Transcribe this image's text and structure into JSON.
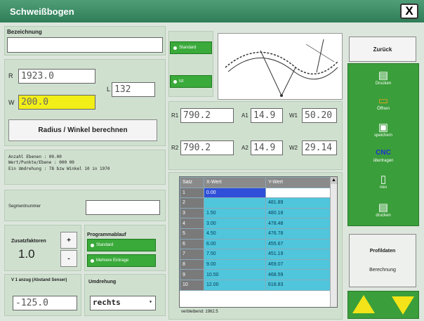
{
  "window": {
    "title": "Schweißbogen",
    "close": "X"
  },
  "left": {
    "bezeichnung_label": "Bezeichnung",
    "bezeichnung_value": "",
    "r_label": "R",
    "r_value": "1923.0",
    "w_label": "W",
    "w_value": "200.0",
    "l_label": "L",
    "l_value": "132",
    "calc_button": "Radius / Winkel berechnen",
    "info_lines": [
      "Anzahl Ebenen : 00.00",
      "Wert/Punkte/Ebene   : 000 00",
      "Ein Umdrehung : 78 bzw Winkel  10 in 1970"
    ],
    "seg_label": "Segmentnummer",
    "seg_value": "",
    "zusatz_label": "Zusatzfaktoren",
    "zusatz_value": "1.0",
    "plus": "+",
    "minus": "-",
    "program_label": "Programmablauf",
    "prog_opt1": "Standard",
    "prog_opt2": "Mehrere Eintrage",
    "v1_label": "V 1 anzug (Abstand Senser)",
    "v1_value": "-125.0",
    "richtung_label": "Umdrehung",
    "richtung_value": "rechts"
  },
  "middle": {
    "opt_top": "Standard",
    "opt_bottom": "Ist",
    "row1": {
      "l1": "R1",
      "v1": "790.2",
      "l2": "A1",
      "v2": "14.9",
      "l3": "W1",
      "v3": "50.20"
    },
    "row2": {
      "l1": "R2",
      "v1": "790.2",
      "l2": "A2",
      "v2": "14.9",
      "l3": "W2",
      "v3": "29.14"
    },
    "table": {
      "headers": [
        "Satz",
        "X-Wert",
        "Y-Wert"
      ],
      "rows": [
        [
          "1",
          "0.00",
          ""
        ],
        [
          "2",
          "",
          "481.89"
        ],
        [
          "3",
          "1.50",
          "480.18"
        ],
        [
          "4",
          "3.00",
          "478.48"
        ],
        [
          "5",
          "4.50",
          "476.78"
        ],
        [
          "6",
          "6.00",
          "455.67"
        ],
        [
          "7",
          "7.50",
          "451.19"
        ],
        [
          "8",
          "9.00",
          "469.07"
        ],
        [
          "9",
          "10.50",
          "468.59"
        ],
        [
          "10",
          "12.00",
          "618.83"
        ]
      ],
      "footer": "verbleibend: 1962.5"
    }
  },
  "sidebar": {
    "top_button": "Zurück",
    "items": [
      {
        "label": "Drucken",
        "icon": "printer-icon",
        "glyph": "▤"
      },
      {
        "label": "Öffnen",
        "icon": "folder-icon",
        "glyph": "▭"
      },
      {
        "label": "speichern",
        "icon": "save-icon",
        "glyph": "▣"
      },
      {
        "label": "übertragen",
        "icon": "cnc-icon",
        "glyph": "CNC"
      },
      {
        "label": "neu",
        "icon": "document-icon",
        "glyph": "▯"
      },
      {
        "label": "drucken",
        "icon": "print-icon",
        "glyph": "▤"
      }
    ],
    "bottom_btn1": "Profildaten",
    "bottom_btn2": "Berechnung"
  }
}
